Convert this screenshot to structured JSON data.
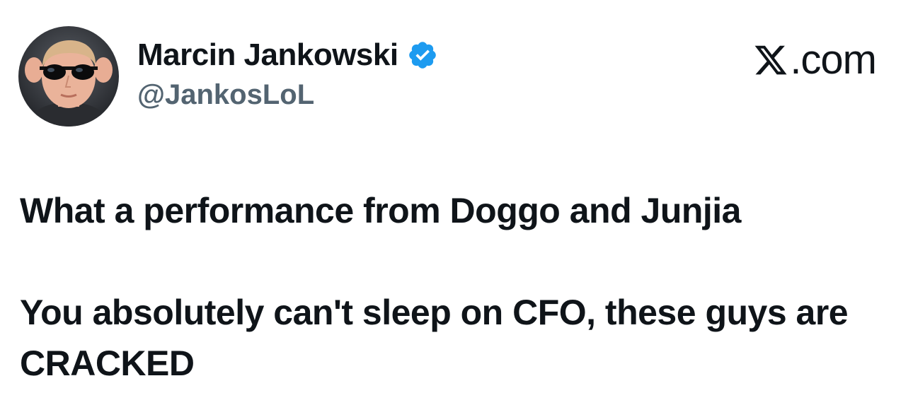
{
  "author": {
    "display_name": "Marcin Jankowski",
    "handle": "@JankosLoL",
    "verified": true,
    "avatar_icon": "profile-photo"
  },
  "brand": {
    "logo_icon": "x-logo-icon",
    "text": ".com"
  },
  "post": {
    "paragraphs": [
      "What a performance from Doggo and Junjia",
      "You absolutely can't sleep on CFO, these guys are CRACKED"
    ]
  },
  "colors": {
    "text_primary": "#0f1419",
    "text_secondary": "#536471",
    "verified_blue": "#1d9bf0",
    "background": "#ffffff"
  }
}
